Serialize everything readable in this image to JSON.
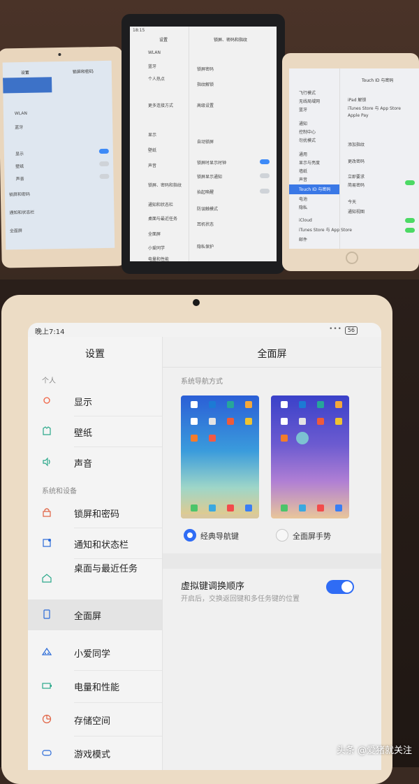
{
  "left_tablet": {
    "header_left": "设置",
    "header_right": "锁屏和密码",
    "rows": [
      "WLAN",
      "蓝牙",
      "显示",
      "壁纸",
      "声音",
      "锁屏和密码",
      "通知和状态栏",
      "全面屏"
    ]
  },
  "middle_tablet": {
    "time": "18:15",
    "header_left": "设置",
    "header_right": "锁屏、密码和指纹",
    "rows_left": [
      "WLAN",
      "蓝牙",
      "个人热点",
      "更多连接方式",
      "显示",
      "壁纸",
      "声音",
      "锁屏、密码和指纹",
      "通知和状态栏",
      "桌面与最近任务",
      "全面屏",
      "小爱同学",
      "电量和性能"
    ],
    "rows_right": [
      "锁屏密码",
      "指纹解锁",
      "高级设置",
      "自动锁屏",
      "锁屏时显示时钟",
      "锁屏显示通知",
      "抬起唤醒",
      "防误触模式",
      "耳机状态",
      "隐私保护"
    ]
  },
  "right_tablet": {
    "header_right": "Touch ID 与密码",
    "rows_left": [
      "飞行模式",
      "无线局域网",
      "蓝牙",
      "通知",
      "控制中心",
      "勿扰模式",
      "通用",
      "显示与亮度",
      "墙纸",
      "声音",
      "Touch ID 与密码",
      "电池",
      "隐私",
      "iCloud",
      "iTunes Store 与 App Store",
      "邮件"
    ],
    "rows_right": [
      "iPad 解锁",
      "iTunes Store 与 App Store",
      "Apple Pay",
      "添加指纹",
      "更改密码",
      "立即要求",
      "简易密码",
      "今天",
      "通知视图"
    ]
  },
  "main": {
    "status": {
      "time": "晚上7:14",
      "dots": "•••",
      "battery": "56"
    },
    "sidebar": {
      "title": "设置",
      "sections": [
        {
          "label": "个人"
        },
        {
          "label": "系统和设备"
        }
      ],
      "items": [
        {
          "label": "显示",
          "icon": "sun-icon"
        },
        {
          "label": "壁纸",
          "icon": "shirt-icon"
        },
        {
          "label": "声音",
          "icon": "speaker-icon"
        },
        {
          "label": "锁屏和密码",
          "icon": "lock-icon"
        },
        {
          "label": "通知和状态栏",
          "icon": "notification-icon"
        },
        {
          "label": "桌面与最近任务",
          "icon": "home-icon"
        },
        {
          "label": "全面屏",
          "icon": "phone-icon",
          "active": true
        },
        {
          "label": "小爱同学",
          "icon": "xiaoai-icon"
        },
        {
          "label": "电量和性能",
          "icon": "battery-icon"
        },
        {
          "label": "存储空间",
          "icon": "storage-icon"
        },
        {
          "label": "游戏模式",
          "icon": "gamepad-icon"
        }
      ]
    },
    "detail": {
      "title": "全面屏",
      "group_label": "系统导航方式",
      "option_classic": "经典导航键",
      "option_gesture": "全面屏手势",
      "selected_option": "经典导航键",
      "swap_title": "虚拟键调换顺序",
      "swap_subtitle": "开启后，交换返回键和多任务键的位置",
      "swap_enabled": true
    },
    "accent_color": "#2f6cf5"
  },
  "watermark": "头条 @爱猪就关注"
}
